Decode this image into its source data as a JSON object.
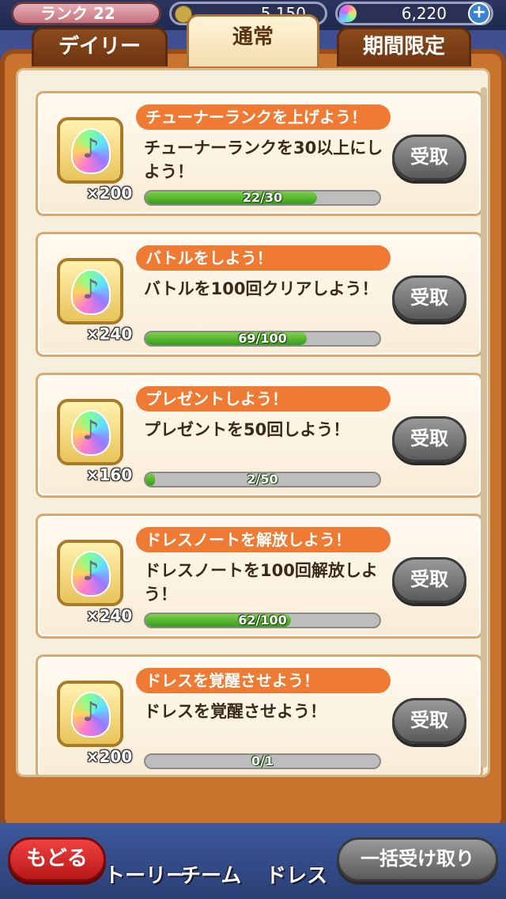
{
  "header": {
    "rank_label": "ランク 22",
    "coins": "5,150",
    "gems": "6,220",
    "plus": "+"
  },
  "tabs": [
    {
      "label": "デイリー",
      "active": false
    },
    {
      "label": "通常",
      "active": true
    },
    {
      "label": "期間限定",
      "active": false
    }
  ],
  "missions": [
    {
      "title": "チューナーランクを上げよう！",
      "desc": "チューナーランクを30以上にしよう！",
      "reward_qty": "×200",
      "progress_text": "22/30",
      "progress": 0.733,
      "claim_label": "受取"
    },
    {
      "title": "バトルをしよう！",
      "desc": "バトルを100回クリアしよう！",
      "reward_qty": "×240",
      "progress_text": "69/100",
      "progress": 0.69,
      "claim_label": "受取"
    },
    {
      "title": "プレゼントしよう！",
      "desc": "プレゼントを50回しよう！",
      "reward_qty": "×160",
      "progress_text": "2/50",
      "progress": 0.04,
      "claim_label": "受取"
    },
    {
      "title": "ドレスノートを解放しよう！",
      "desc": "ドレスノートを100回解放しよう！",
      "reward_qty": "×240",
      "progress_text": "62/100",
      "progress": 0.62,
      "claim_label": "受取"
    },
    {
      "title": "ドレスを覚醒させよう！",
      "desc": "ドレスを覚醒させよう！",
      "reward_qty": "×200",
      "progress_text": "0/1",
      "progress": 0.0,
      "claim_label": "受取"
    }
  ],
  "footer": {
    "back_label": "もどる",
    "bulk_label": "一括受け取り",
    "nav": [
      "トーリー",
      "チーム",
      "ドレス"
    ]
  }
}
